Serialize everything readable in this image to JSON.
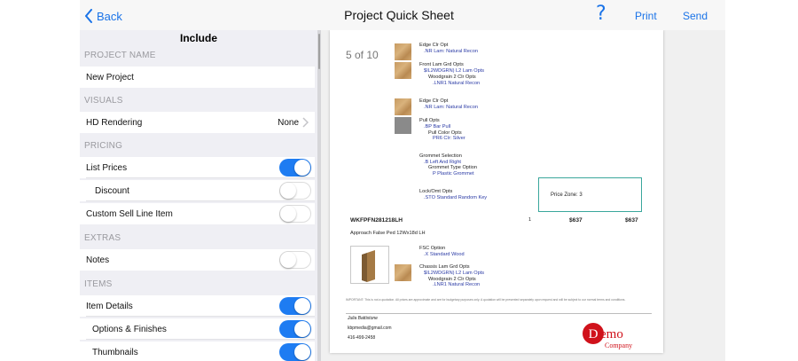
{
  "nav": {
    "back_label": "Back",
    "title": "Project Quick Sheet",
    "help_label": "?",
    "print_label": "Print",
    "send_label": "Send"
  },
  "panel": {
    "title": "Include",
    "project_name_header": "PROJECT NAME",
    "project_name_value": "New Project",
    "visuals_header": "VISUALS",
    "hd_rendering_label": "HD Rendering",
    "hd_rendering_value": "None",
    "pricing_header": "PRICING",
    "list_prices_label": "List Prices",
    "list_prices_on": true,
    "discount_label": "Discount",
    "discount_on": false,
    "custom_sell_label": "Custom Sell Line Item",
    "custom_sell_on": false,
    "extras_header": "EXTRAS",
    "notes_label": "Notes",
    "notes_on": false,
    "items_header": "ITEMS",
    "item_details_label": "Item Details",
    "item_details_on": true,
    "options_finishes_label": "Options & Finishes",
    "options_finishes_on": true,
    "thumbnails_label": "Thumbnails",
    "thumbnails_on": true
  },
  "doc": {
    "page_indicator": "5 of 10",
    "opt1_title": "Edge Clr Opt",
    "opt1_value": ".NR  Lam: Natural Recon",
    "opt2_title": "Front Lam Grd Opts",
    "opt2_value": "$IL2WDGRN)  L2 Lam Opts",
    "opt2_sub_title": "Woodgrain 2 Clr Opts",
    "opt2_sub_value": ".LNR1  Natural Recon",
    "opt3_title": "Edge Clr Opt",
    "opt3_value": ".NR  Lam: Natural Recon",
    "opt4_title": "Pull Opts",
    "opt4_value": ".BP  Bar Pull",
    "opt4_sub_title": "Pull Color Opts",
    "opt4_sub_value": "PR6  Clr: Silver",
    "opt5_title": "Grommet Selection",
    "opt5_value": ".B  Left And Right",
    "opt5_sub_title": "Grommet Type Option",
    "opt5_sub_value": "P  Plastic Grommet",
    "opt6_title": "Lock/Omt Opts",
    "opt6_value": ".STO  Standard Random Key",
    "price_zone": "Price Zone: 3",
    "item_code": "WKFPFN281218LH",
    "item_qty": "1",
    "item_price": "$637",
    "item_total": "$637",
    "item_desc": "Approach False Ped 12Wx18d LH",
    "opt7_title": "FSC Option",
    "opt7_value": ".X  Standard Wood",
    "opt8_title": "Chassis Lam Grd Opts",
    "opt8_value": "$IL2WDGRN)  L2 Lam Opts",
    "opt8_sub_title": "Woodgrain 2 Clr Opts",
    "opt8_sub_value": ".LNR1  Natural Recon",
    "disclaimer": "IMPORTANT: This is not a quotation. All prices are approximate and are for budgetary purposes only. A quotation will be presented separately upon request and will be subject to our normal terms and conditions.",
    "contact_name": "Julia Battistone",
    "contact_email": "kbpmedia@gmail.com",
    "contact_phone": "416-499-2458",
    "logo_word1": "Demo",
    "logo_word2": "Company"
  },
  "colors": {
    "accent": "#1a73e8",
    "toggle_on": "#1e7cf2",
    "price_zone_border": "#3aa79c",
    "logo_red": "#d0121b"
  }
}
